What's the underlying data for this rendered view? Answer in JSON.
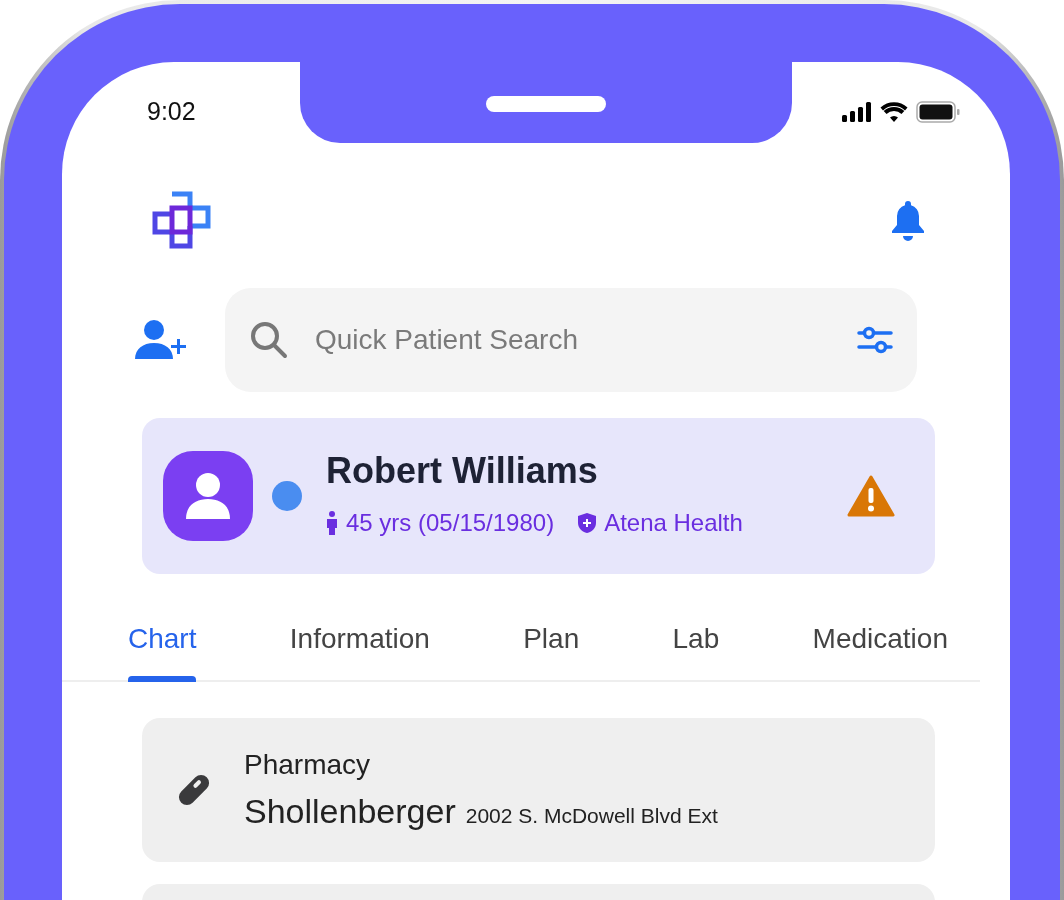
{
  "status_bar": {
    "time": "9:02"
  },
  "search": {
    "placeholder": "Quick Patient Search"
  },
  "patient": {
    "name": "Robert Williams",
    "online": true,
    "age": "45 yrs (05/15/1980)",
    "insurer": "Atena Health",
    "alert": true
  },
  "tabs": [
    {
      "label": "Chart",
      "selected": true
    },
    {
      "label": "Information",
      "selected": false
    },
    {
      "label": "Plan",
      "selected": false
    },
    {
      "label": "Lab",
      "selected": false
    },
    {
      "label": "Medication",
      "selected": false
    }
  ],
  "cards": [
    {
      "label": "Pharmacy",
      "name": "Shollenberger",
      "address": "2002 S. McDowell Blvd Ext"
    }
  ]
}
